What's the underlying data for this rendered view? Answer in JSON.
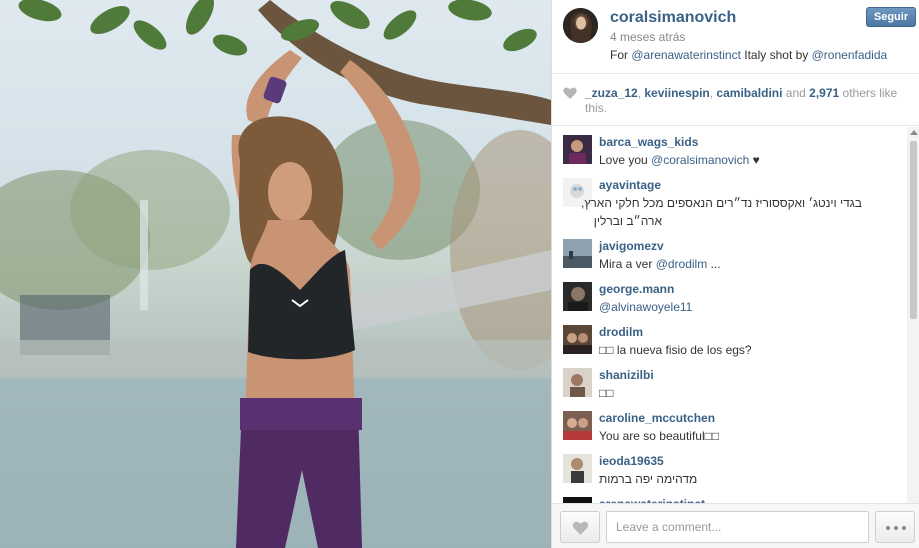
{
  "post": {
    "username": "coralsimanovich",
    "time_ago": "4 meses atrás",
    "caption_prefix": "For ",
    "caption_mention_1": "@arenawaterinstinct",
    "caption_middle": " Italy shot by ",
    "caption_mention_2": "@ronenfadida",
    "follow_label": "Seguir"
  },
  "likes": {
    "likers": [
      "_zuza_12",
      "keviinespin",
      "camibaldini"
    ],
    "sep": ", ",
    "and_text": " and ",
    "count": "2,971",
    "suffix": " others like this."
  },
  "comments": [
    {
      "user": "barca_wags_kids",
      "prefix": "Love you ",
      "mention": "@coralsimanovich",
      "suffix": " ♥"
    },
    {
      "user": "ayavintage",
      "text": "בגדי וינטג׳ ואקססוריז נד״רים הנאספים מכל חלקי הארץ,",
      "text2": "ארה״ב וברלין"
    },
    {
      "user": "javigomezv",
      "prefix": "Mira a ver ",
      "mention": "@drodilm",
      "suffix": " ..."
    },
    {
      "user": "george.mann",
      "prefix": "",
      "mention": "@alvinawoyele11",
      "suffix": ""
    },
    {
      "user": "drodilm",
      "prefix": "",
      "mention": "",
      "suffix": "la nueva fisio de los egs?"
    },
    {
      "user": "shanizilbi",
      "prefix": "",
      "mention": "",
      "suffix": ""
    },
    {
      "user": "caroline_mccutchen",
      "prefix": "You are so beautiful",
      "mention": "",
      "suffix": ""
    },
    {
      "user": "ieoda19635",
      "text": "מדהימה יפה ברמות"
    },
    {
      "user": "arenawaterinstinct",
      "prefix": "",
      "mention": "",
      "suffix": ""
    }
  ],
  "footer": {
    "comment_placeholder": "Leave a comment..."
  },
  "colors": {
    "link": "#3a6186",
    "follow_button": "#5a83ad"
  },
  "icons": {
    "likes": "heart-icon",
    "like_button": "heart-icon",
    "more_button": "ellipsis-icon"
  }
}
